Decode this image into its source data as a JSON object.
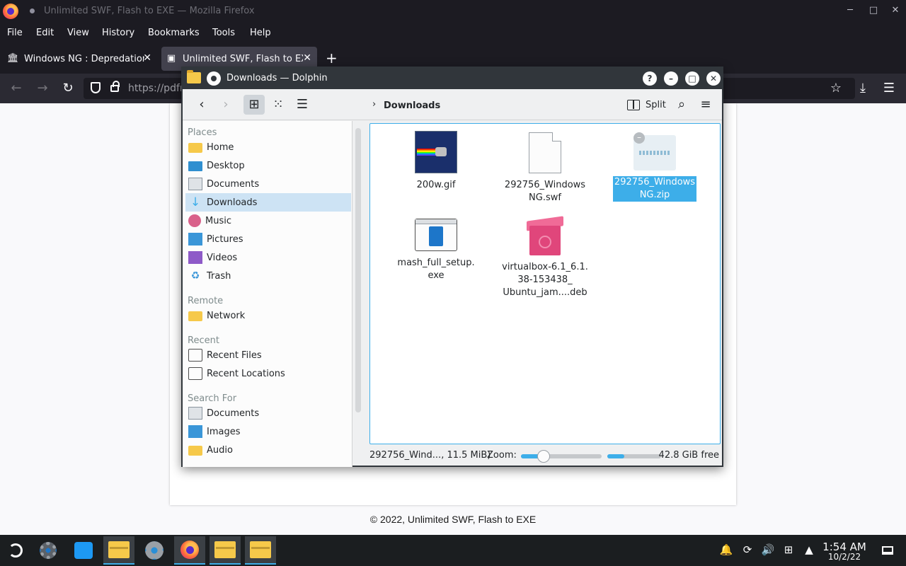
{
  "firefox": {
    "window_title": "Unlimited SWF, Flash to EXE — Mozilla Firefox",
    "menu": [
      "File",
      "Edit",
      "View",
      "History",
      "Bookmarks",
      "Tools",
      "Help"
    ],
    "tabs": [
      {
        "label": "Windows NG : Depredation",
        "active": false
      },
      {
        "label": "Unlimited SWF, Flash to EXE",
        "active": true
      }
    ],
    "url": "https://pdfr",
    "page_footer": "© 2022, Unlimited SWF, Flash to EXE"
  },
  "dolphin": {
    "title": "Downloads — Dolphin",
    "breadcrumb": "Downloads",
    "split_label": "Split",
    "sidebar": {
      "places_title": "Places",
      "places": [
        "Home",
        "Desktop",
        "Documents",
        "Downloads",
        "Music",
        "Pictures",
        "Videos",
        "Trash"
      ],
      "remote_title": "Remote",
      "remote": [
        "Network"
      ],
      "recent_title": "Recent",
      "recent": [
        "Recent Files",
        "Recent Locations"
      ],
      "search_title": "Search For",
      "search": [
        "Documents",
        "Images",
        "Audio"
      ]
    },
    "active_place": "Downloads",
    "files": [
      {
        "name_lines": [
          "200w.gif"
        ],
        "type": "gif",
        "selected": false
      },
      {
        "name_lines": [
          "292756_Windows",
          "NG.swf"
        ],
        "type": "swf",
        "selected": false
      },
      {
        "name_lines": [
          "292756_Windows",
          "NG.zip"
        ],
        "type": "zip",
        "selected": true
      },
      {
        "name_lines": [
          "mash_full_setup.",
          "exe"
        ],
        "type": "exe",
        "selected": false
      },
      {
        "name_lines": [
          "virtualbox-6.1_6.1.",
          "38-153438_",
          "Ubuntu_jam....deb"
        ],
        "type": "deb",
        "selected": false
      }
    ],
    "status": {
      "selection": "292756_Wind..., 11.5 MiB)",
      "zoom_label": "Zoom:",
      "zoom_level": 0.28,
      "disk_used_fraction": 0.32,
      "free_space": "42.8 GiB free"
    }
  },
  "taskbar": {
    "clock_time": "1:54 AM",
    "clock_date": "10/2/22"
  }
}
